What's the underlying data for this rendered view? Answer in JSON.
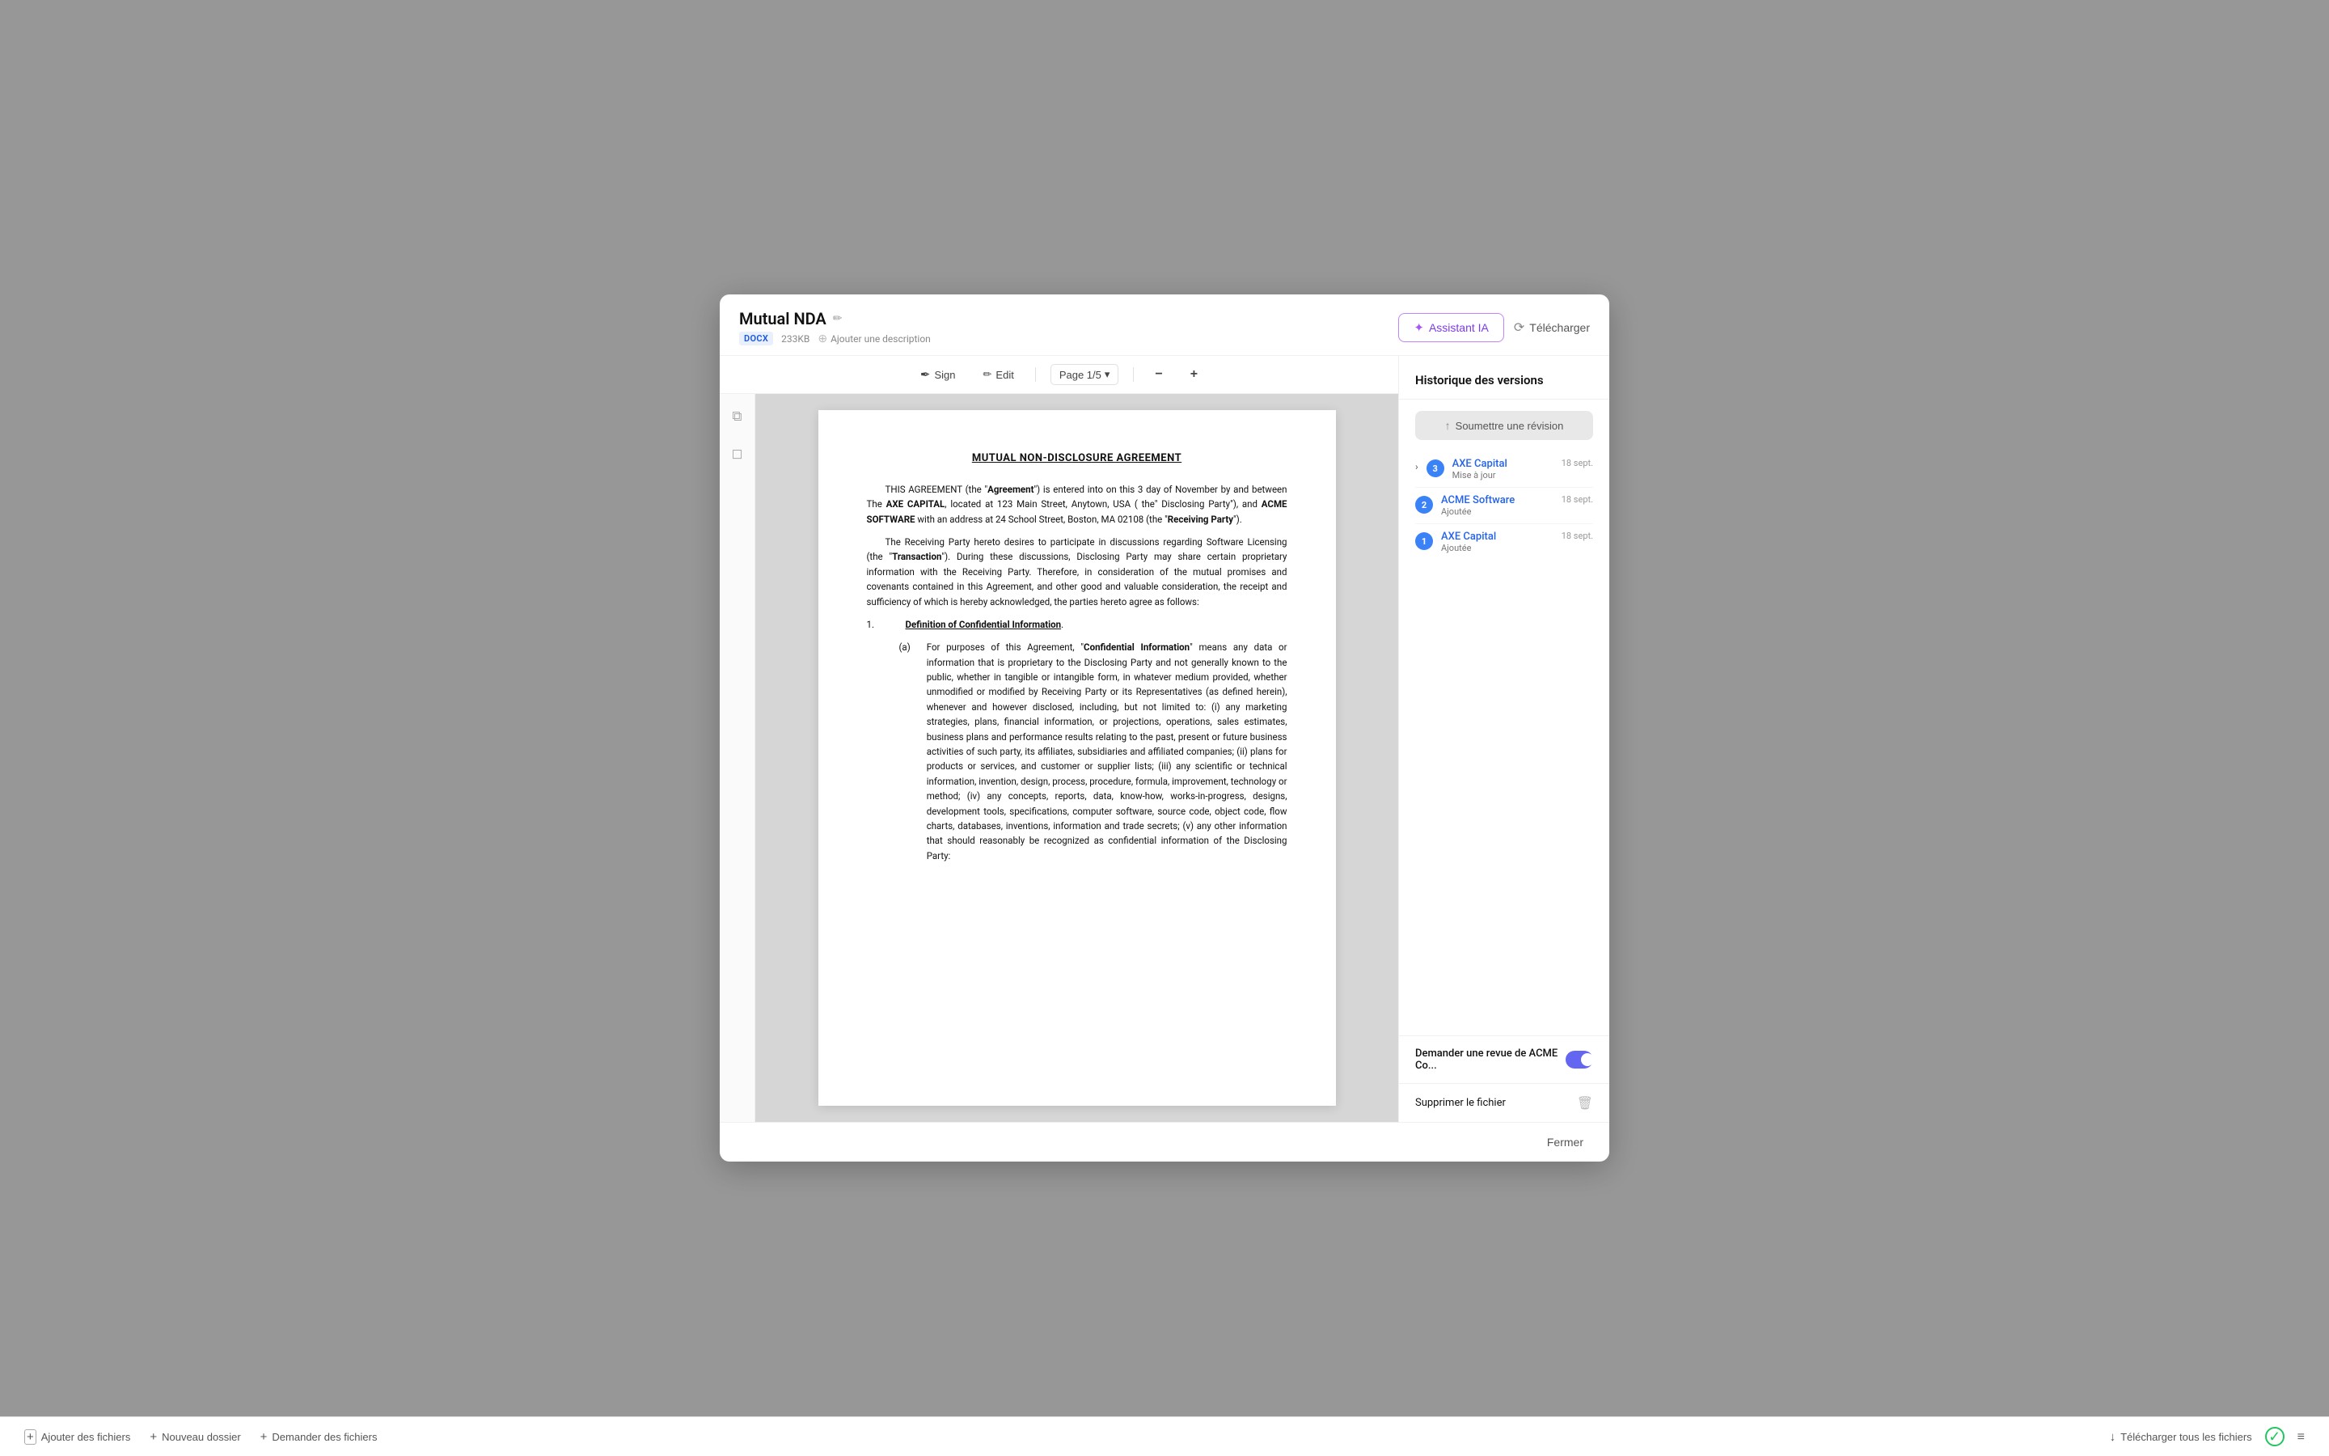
{
  "modal": {
    "title": "Mutual NDA",
    "file_badge": "DOCX",
    "file_size": "233KB",
    "add_description": "Ajouter une description",
    "btn_assistant": "Assistant IA",
    "btn_download": "Télécharger"
  },
  "toolbar": {
    "sign_label": "Sign",
    "edit_label": "Edit",
    "page_label": "Page 1/5"
  },
  "document": {
    "title": "MUTUAL NON-DISCLOSURE AGREEMENT",
    "para1": "THIS AGREEMENT (the \"Agreement\") is entered into on this 3 day of  November by and between  The AXE CAPITAL, located at  123 Main Street, Anytown, USA  ( the\" Disclosing Party\"), and ACME SOFTWARE with an address at  24 School Street, Boston, MA 02108 (the \"Receiving Party\").",
    "para2": "The Receiving Party hereto desires to participate in discussions regarding Software Licensing (the \"Transaction\").  During these discussions, Disclosing Party may share certain proprietary information with the Receiving Party.  Therefore, in consideration of the mutual promises and covenants contained in this Agreement, and other good and valuable consideration, the receipt and sufficiency of which is hereby acknowledged, the parties hereto agree as follows:",
    "section1_title": "Definition of Confidential Information",
    "section1a_label": "(a)",
    "section1a_text": "For purposes of this Agreement, \"Confidential Information\" means any data or information that is proprietary to the Disclosing Party and not generally known to the public, whether in tangible or intangible form, in whatever medium provided, whether unmodified or modified by Receiving Party or its Representatives (as defined herein), whenever and however disclosed, including, but not limited to: (i) any marketing strategies, plans, financial information, or projections, operations, sales estimates, business plans and performance results relating to the past, present or future business activities of such party, its affiliates, subsidiaries and affiliated companies; (ii) plans for products or services, and customer or supplier lists; (iii) any scientific or technical information, invention, design, process, procedure, formula, improvement, technology or method; (iv) any concepts, reports, data, know-how, works-in-progress, designs, development tools, specifications, computer software, source code, object code, flow charts, databases, inventions, information and trade secrets; (v) any other information that should reasonably be recognized as confidential information of the Disclosing Party:"
  },
  "right_panel": {
    "title": "Historique des versions",
    "submit_revision": "Soumettre une révision",
    "versions": [
      {
        "number": "3",
        "name": "AXE Capital",
        "action": "Mise à jour",
        "date": "18 sept.",
        "color": "badge-blue",
        "expanded": true
      },
      {
        "number": "2",
        "name": "ACME Software",
        "action": "Ajoutée",
        "date": "18 sept.",
        "color": "badge-blue"
      },
      {
        "number": "1",
        "name": "AXE Capital",
        "action": "Ajoutée",
        "date": "18 sept.",
        "color": "badge-blue"
      }
    ],
    "ask_review_label": "Demander une revue de ACME Co...",
    "toggle_checked": true,
    "delete_label": "Supprimer le fichier"
  },
  "footer": {
    "close_label": "Fermer"
  },
  "bottom_bar": {
    "add_files": "Ajouter des fichiers",
    "new_folder": "Nouveau dossier",
    "request_files": "Demander des fichiers",
    "download_all": "Télécharger tous les fichiers"
  },
  "icons": {
    "edit": "✏️",
    "star": "✦",
    "download_cloud": "↓",
    "sign": "✍",
    "chevron_down": "▾",
    "zoom_out": "−",
    "zoom_in": "+",
    "copy": "⧉",
    "bookmark": "🔖",
    "cloud_upload": "↑",
    "chevron_right": "›",
    "trash": "🗑",
    "toggle_icon": "≡",
    "checkmark": "✓"
  }
}
